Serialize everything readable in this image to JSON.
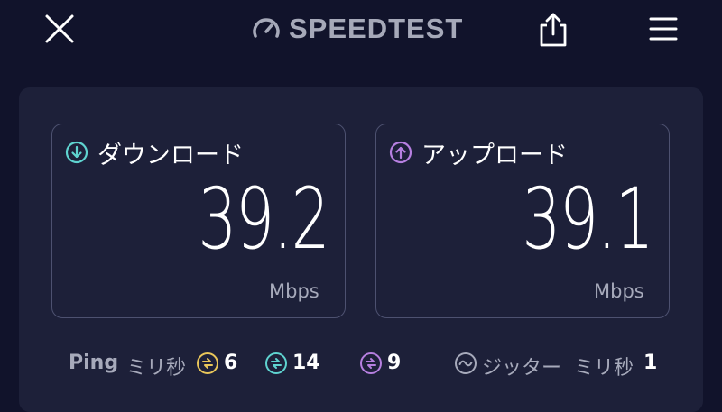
{
  "header": {
    "brand": "SPEEDTEST",
    "icons": {
      "close": "close-icon",
      "speedometer": "speedometer-icon",
      "share": "share-icon",
      "menu": "menu-icon"
    }
  },
  "download": {
    "label": "ダウンロード",
    "value": "39.2",
    "unit": "Mbps",
    "icon": "download-arrow-icon",
    "accent": "#5fd3d0"
  },
  "upload": {
    "label": "アップロード",
    "value": "39.1",
    "unit": "Mbps",
    "icon": "upload-arrow-icon",
    "accent": "#b67fe0"
  },
  "stats": {
    "ping_label": "Ping",
    "ping_unit": "ミリ秒",
    "ping_idle": "6",
    "ping_download": "14",
    "ping_upload": "9",
    "jitter_label": "ジッター",
    "jitter_unit": "ミリ秒",
    "jitter_value": "1",
    "colors": {
      "idle": "#e9c65a",
      "download": "#5fd3d0",
      "upload": "#b67fe0",
      "jitter": "#a7aabb"
    }
  },
  "colors": {
    "background": "#11132b",
    "panel": "#1d2039",
    "card_border": "#4d5170",
    "muted_text": "#a7aabb"
  }
}
